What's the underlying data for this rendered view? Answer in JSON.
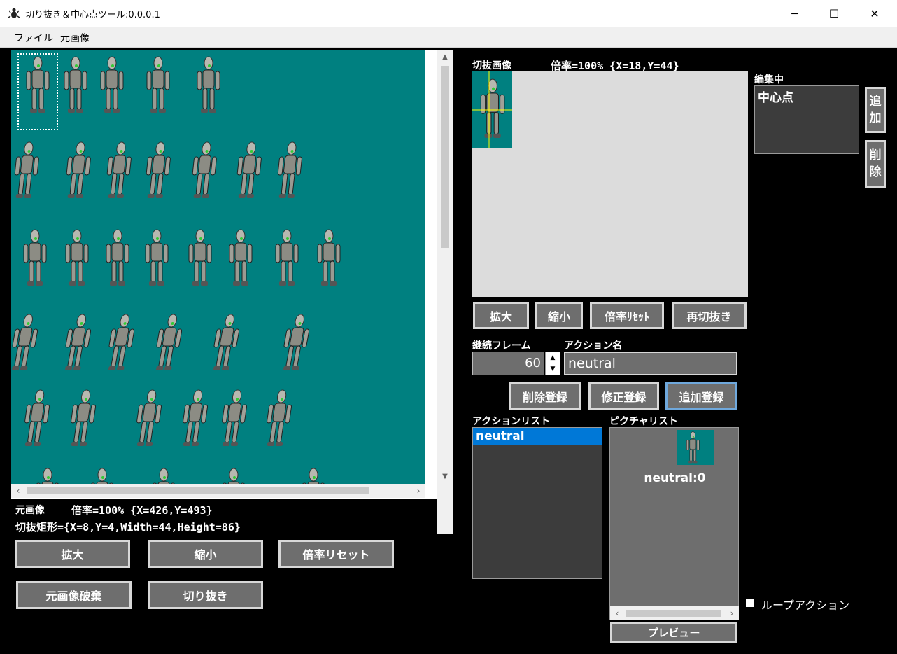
{
  "window": {
    "title": "切り抜き＆中心点ツール:0.0.0.1",
    "minimize": "─",
    "maximize": "☐",
    "close": "✕"
  },
  "menu": [
    "ファイル",
    "元画像"
  ],
  "source": {
    "label": "元画像",
    "zoom_text": "倍率=100%  {X=426,Y=493}",
    "rect_text": "切抜矩形={X=8,Y=4,Width=44,Height=86}",
    "buttons": {
      "zoom_in": "拡大",
      "zoom_out": "縮小",
      "zoom_reset": "倍率リセット",
      "discard": "元画像破棄",
      "cut": "切り抜き"
    }
  },
  "cut": {
    "label": "切抜画像",
    "zoom_text": "倍率=100%  {X=18,Y=44}",
    "buttons": {
      "zoom_in": "拡大",
      "zoom_out": "縮小",
      "zoom_reset": "倍率ﾘｾｯﾄ",
      "recut": "再切抜き"
    }
  },
  "editing": {
    "label": "編集中",
    "items": [
      "中心点"
    ],
    "add_button": [
      "追",
      "加"
    ],
    "delete_button": [
      "削",
      "除"
    ]
  },
  "frame": {
    "label": "継続フレーム",
    "value": "60"
  },
  "action_name": {
    "label": "アクション名",
    "value": "neutral"
  },
  "register_buttons": {
    "delete": "削除登録",
    "modify": "修正登録",
    "add": "追加登録"
  },
  "action_list": {
    "label": "アクションリスト",
    "items": [
      "neutral"
    ]
  },
  "picture_list": {
    "label": "ピクチャリスト",
    "items": [
      "neutral:0"
    ],
    "preview_button": "プレビュー"
  },
  "loop_action": {
    "label": "ループアクション",
    "checked": false
  },
  "colors": {
    "canvas_bg": "#008080",
    "button_bg": "#6e6e6e",
    "selection": "#0078d7"
  }
}
